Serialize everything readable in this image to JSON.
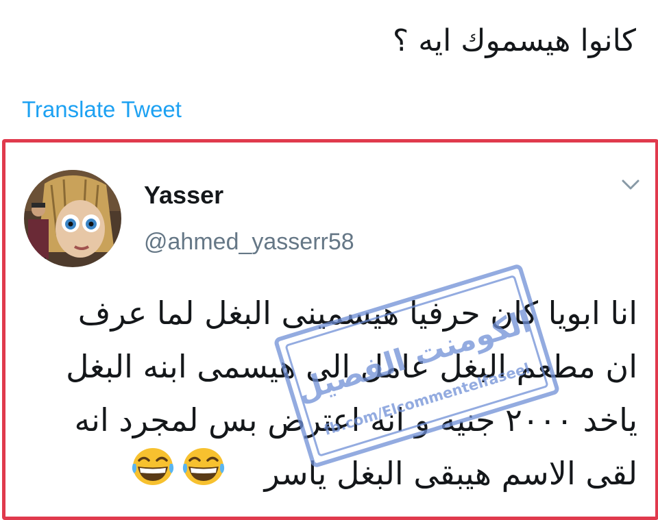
{
  "top_tweet": {
    "text": "كانوا هيسموك ايه ؟",
    "translate_label": "Translate Tweet"
  },
  "quoted_tweet": {
    "display_name": "Yasser",
    "handle": "@ahmed_yasserr58",
    "text": "انا ابويا كان حرفيا هيسمينى البغل لما عرف\nان مطعم البغل عامل الى هيسمى ابنه البغل\nياخد ٢٠٠٠ جنيه و انه اعترض بس لمجرد انه\nلقى الاسم هيبقى البغل ياسر",
    "emojis": [
      "laughing-emoji",
      "laughing-emoji"
    ]
  },
  "watermark": {
    "title": "الكومنت الفصيل",
    "url": "fb.com/Elcommentelfaseel"
  },
  "colors": {
    "frame_border": "#e03a4d",
    "link": "#1da1f2",
    "handle_gray": "#657786",
    "watermark_blue": "#6f8fd6"
  }
}
